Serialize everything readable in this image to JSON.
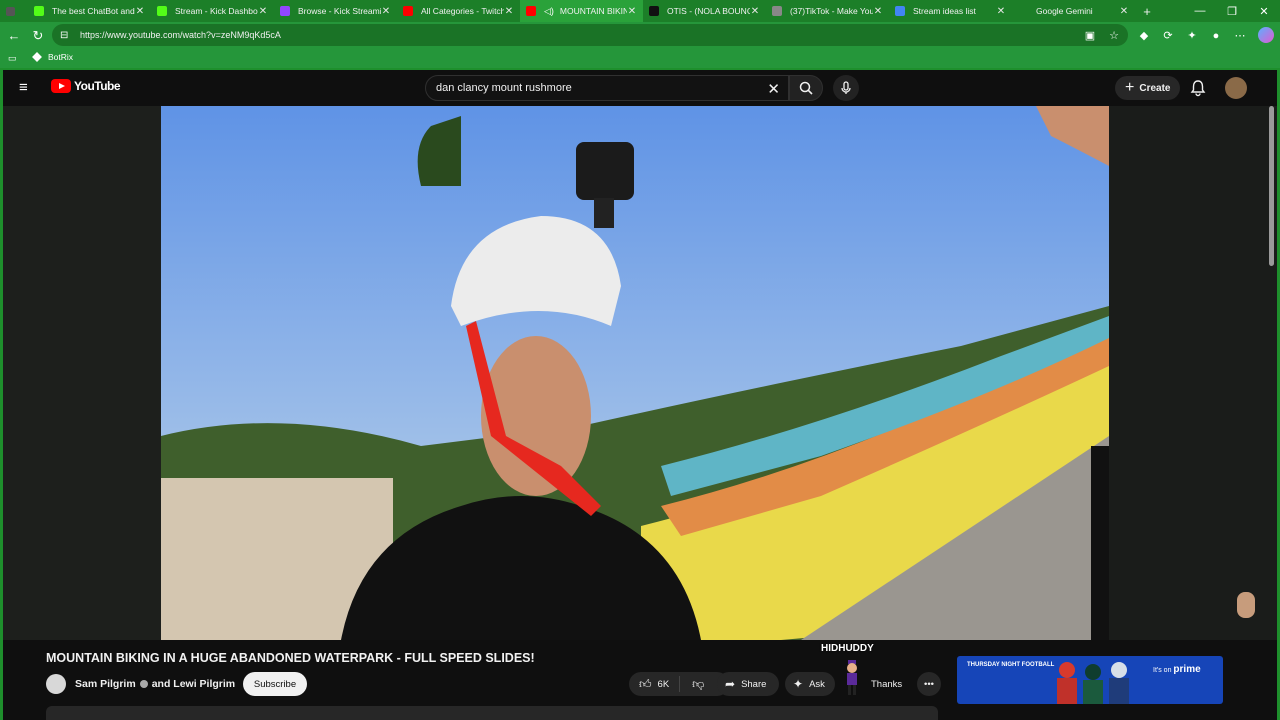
{
  "tabs": [
    {
      "label": "The best ChatBot and",
      "color": "#555555"
    },
    {
      "label": "Stream - Kick Dashboa",
      "color": "#53fc18"
    },
    {
      "label": "Browse - Kick Streamin",
      "color": "#53fc18"
    },
    {
      "label": "All Categories - Twitch",
      "color": "#9146ff"
    },
    {
      "label": "MOUNTAIN BIKIN",
      "color": "#ff0000"
    },
    {
      "label": "OTIS - (NOLA BOUNCE",
      "color": "#ff0000"
    },
    {
      "label": "(37)TikTok - Make You",
      "color": "#111111"
    },
    {
      "label": "Stream ideas list",
      "color": "#888888"
    },
    {
      "label": "Google Gemini",
      "color": "#4285f4"
    }
  ],
  "address": {
    "url": "https://www.youtube.com/watch?v=zeNM9qKd5cA"
  },
  "bookmarks": {
    "botrix": "BotRix"
  },
  "youtube": {
    "logo_text": "YouTube",
    "search_value": "dan clancy mount rushmore",
    "create_label": "Create",
    "video_title": "MOUNTAIN BIKING IN A HUGE ABANDONED WATERPARK - FULL SPEED SLIDES!",
    "channel": "Sam Pilgrim",
    "channel_with": "and Lewi Pilgrim",
    "subscribe_label": "Subscribe",
    "like_count": "6K",
    "share_label": "Share",
    "ask_label": "Ask",
    "thanks_label": "Thanks",
    "overlay_username": "HIDHUDDY",
    "ad_left": "THURSDAY NIGHT FOOTBALL",
    "ad_right_small": "It's on",
    "ad_right_brand": "prime"
  }
}
